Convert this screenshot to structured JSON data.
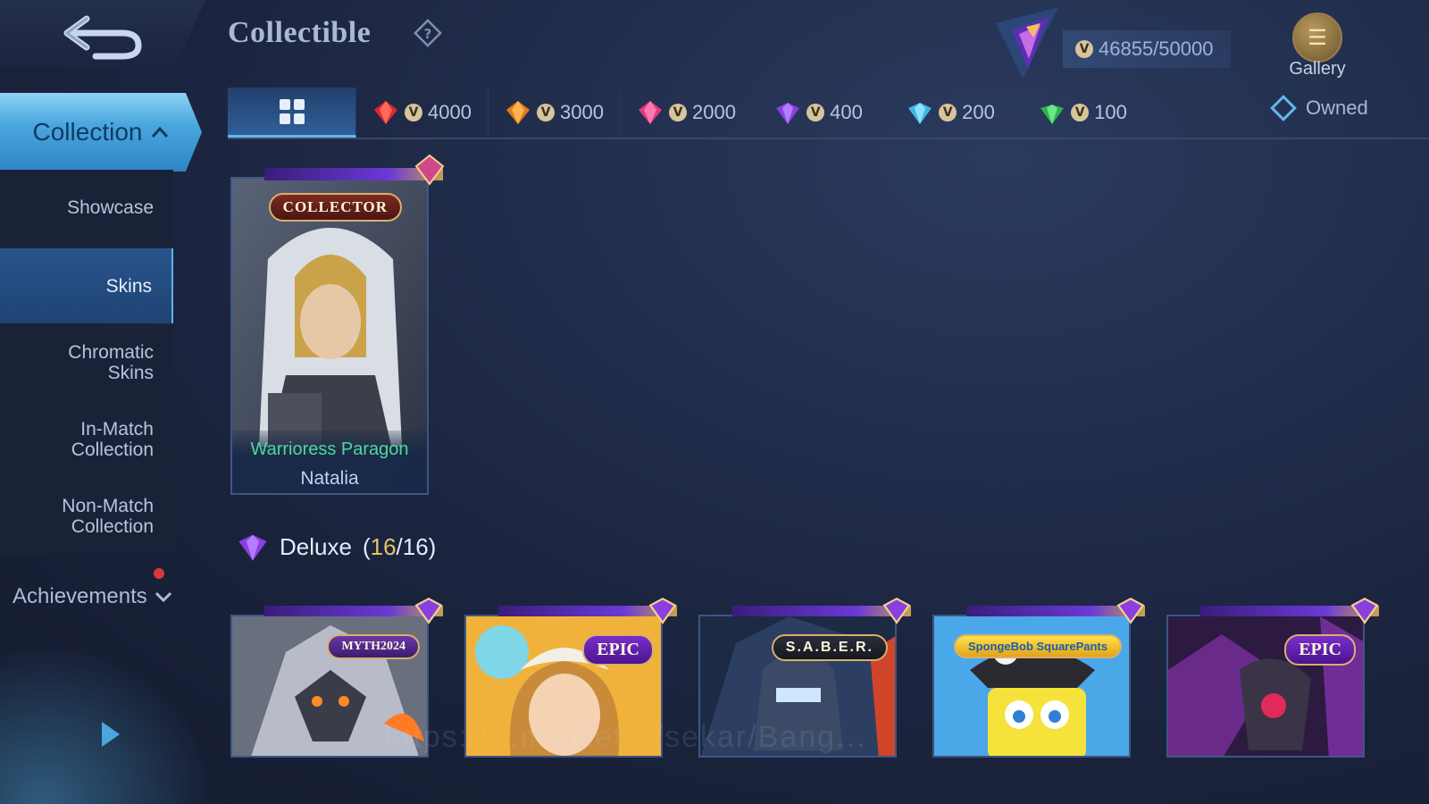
{
  "header": {
    "title": "Collectible",
    "back_icon": "back-arrow-icon",
    "help_icon": "help-diamond-icon",
    "points": "46855/50000",
    "gallery_label": "Gallery"
  },
  "sidebar": {
    "collection_label": "Collection",
    "items": [
      {
        "label": "Showcase"
      },
      {
        "label": "Skins"
      },
      {
        "label": "Chromatic Skins"
      },
      {
        "label": "In-Match Collection"
      },
      {
        "label": "Non-Match Collection"
      }
    ],
    "achievements_label": "Achievements"
  },
  "tabs": [
    {
      "value": "4000",
      "gem_color": "#e0262e"
    },
    {
      "value": "3000",
      "gem_color": "#e07a1e"
    },
    {
      "value": "2000",
      "gem_color": "#e23a7e"
    },
    {
      "value": "400",
      "gem_color": "#8a3fe0"
    },
    {
      "value": "200",
      "gem_color": "#3fb6e0"
    },
    {
      "value": "100",
      "gem_color": "#2fb44a"
    }
  ],
  "owned_label": "Owned",
  "featured": {
    "badge": "COLLECTOR",
    "skin_name": "Warrioress Paragon",
    "hero_name": "Natalia"
  },
  "section": {
    "name": "Deluxe",
    "open": "(",
    "current": "16",
    "total": "/16)"
  },
  "deluxe_cards": [
    {
      "badge": "MYTH2024"
    },
    {
      "badge": "EPIC"
    },
    {
      "badge": "S.A.B.E.R."
    },
    {
      "badge": "SpongeBob SquarePants"
    },
    {
      "badge": "EPIC"
    }
  ],
  "watermark": "https://...market.../sekar/Bang..."
}
